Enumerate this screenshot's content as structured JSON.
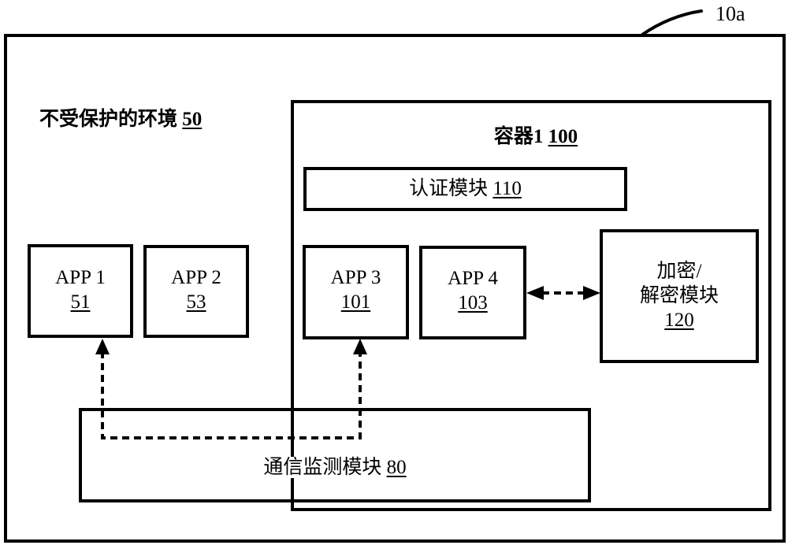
{
  "figure_ref": "10a",
  "unprotected_env": {
    "label": "不受保护的环境",
    "ref": "50"
  },
  "container": {
    "label": "容器1",
    "ref": "100"
  },
  "auth_module": {
    "label": "认证模块",
    "ref": "110"
  },
  "apps": [
    {
      "label": "APP 1",
      "ref": "51"
    },
    {
      "label": "APP 2",
      "ref": "53"
    },
    {
      "label": "APP 3",
      "ref": "101"
    },
    {
      "label": "APP 4",
      "ref": "103"
    }
  ],
  "crypto_module": {
    "line1": "加密/",
    "line2": "解密模块",
    "ref": "120"
  },
  "comm_monitor": {
    "label": "通信监测模块",
    "ref": "80"
  },
  "connections": [
    {
      "from": "comm_monitor",
      "to": "APP 1",
      "style": "dashed",
      "direction": "to"
    },
    {
      "from": "comm_monitor",
      "to": "APP 3",
      "style": "dashed",
      "direction": "to"
    },
    {
      "from": "APP 4",
      "to": "crypto_module",
      "style": "dashed",
      "direction": "both"
    }
  ]
}
